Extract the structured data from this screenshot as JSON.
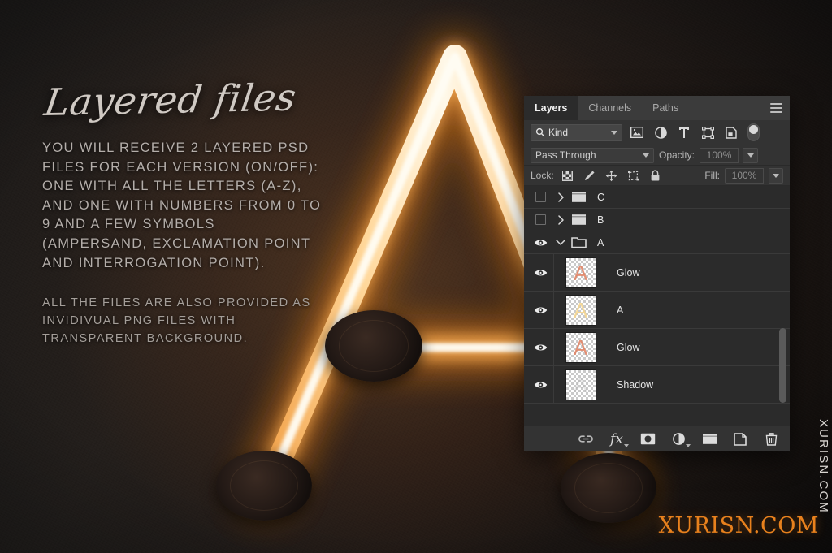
{
  "marketing": {
    "headline": "Layered files",
    "paragraph_1": "YOU WILL RECEIVE 2 LAYERED PSD FILES FOR EACH VERSION (ON/OFF): ONE WITH ALL THE LETTERS (A-Z), AND ONE WITH NUMBERS FROM 0 TO 9 AND A FEW SYMBOLS (AMPERSAND, EXCLAMATION POINT AND INTERROGATION POINT).",
    "paragraph_2": "ALL THE FILES ARE ALSO PROVIDED AS INVIDIVUAL PNG FILES WITH TRANSPARENT BACKGROUND."
  },
  "artwork": {
    "letter": "A",
    "description": "glowing neon tube letter A mounted on dark wall",
    "neon_core_color": "#fff6e0",
    "neon_glow_color": "#ff9c3a",
    "background_color": "#171413"
  },
  "watermarks": {
    "vertical": "XURISN.COM",
    "brand": "XURISN.COM",
    "brand_color": "#e8811d"
  },
  "panel": {
    "tabs": [
      {
        "label": "Layers",
        "active": true
      },
      {
        "label": "Channels",
        "active": false
      },
      {
        "label": "Paths",
        "active": false
      }
    ],
    "menu_icon": "hamburger-menu-icon",
    "filter": {
      "kind_label": "Kind",
      "search_icon": "search-icon",
      "icons": [
        "pixel-layer-filter-icon",
        "adjustment-layer-filter-icon",
        "type-layer-filter-icon",
        "shape-layer-filter-icon",
        "smart-object-filter-icon"
      ],
      "toggle": "filter-enable-toggle"
    },
    "blend": {
      "mode": "Pass Through",
      "opacity_label": "Opacity:",
      "opacity_value": "100%"
    },
    "lock": {
      "label": "Lock:",
      "icons": [
        "lock-transparent-pixels-icon",
        "lock-image-pixels-icon",
        "lock-position-icon",
        "lock-artboard-nesting-icon",
        "lock-all-icon"
      ],
      "fill_label": "Fill:",
      "fill_value": "100%"
    },
    "layers": [
      {
        "name": "C",
        "type": "group",
        "visible": false,
        "expanded": false,
        "thumb": null
      },
      {
        "name": "B",
        "type": "group",
        "visible": false,
        "expanded": false,
        "thumb": null
      },
      {
        "name": "A",
        "type": "group",
        "visible": true,
        "expanded": true,
        "thumb": null
      },
      {
        "name": "Glow",
        "type": "layer",
        "visible": true,
        "expanded": false,
        "thumb": "glow"
      },
      {
        "name": "A",
        "type": "layer",
        "visible": true,
        "expanded": false,
        "thumb": "letter"
      },
      {
        "name": "Glow",
        "type": "layer",
        "visible": true,
        "expanded": false,
        "thumb": "glow"
      },
      {
        "name": "Shadow",
        "type": "layer",
        "visible": true,
        "expanded": false,
        "thumb": "shadow"
      }
    ],
    "toolbar_buttons": [
      "link-layers-icon",
      "layer-style-fx-icon",
      "add-layer-mask-icon",
      "new-adjustment-layer-icon",
      "new-group-icon",
      "new-layer-icon",
      "delete-layer-icon"
    ],
    "scrollbar": "layer-list-scrollbar"
  }
}
